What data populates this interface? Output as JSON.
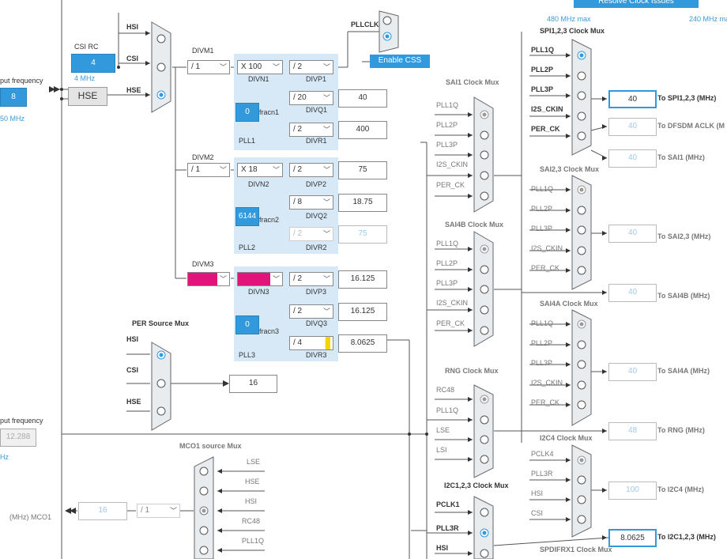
{
  "top": {
    "resolve_btn": "Resolve Clock Issues",
    "max480": "480 MHz max",
    "max240": "240 MHz max"
  },
  "left": {
    "in_freq": "put frequency",
    "hse_val": "8",
    "hse_range": "50 MHz",
    "csi_rc": "CSI RC",
    "csi_val": "4",
    "csi_mhz": "4 MHz",
    "hse_label": "HSE",
    "in_freq2": "put frequency",
    "val_12288": "12.288",
    "hz": "Hz"
  },
  "pll_src": {
    "hsi": "HSI",
    "csi": "CSI",
    "hse": "HSE"
  },
  "pll1": {
    "divm_label": "DIVM1",
    "divm": "/ 1",
    "divn": "X 100",
    "divn_label": "DIVN1",
    "divp": "/ 2",
    "divp_label": "DIVP1",
    "divq": "/ 20",
    "divq_label": "DIVQ1",
    "divq_out": "40",
    "divr": "/ 2",
    "divr_label": "DIVR1",
    "divr_out": "400",
    "frac": "0",
    "frac_label": "fracn1",
    "name": "PLL1"
  },
  "pll2": {
    "divm_label": "DIVM2",
    "divm": "/ 1",
    "divn": "X 18",
    "divn_label": "DIVN2",
    "divp": "/ 2",
    "divp_label": "DIVP2",
    "divp_out": "75",
    "divq": "/ 8",
    "divq_label": "DIVQ2",
    "divq_out": "18.75",
    "divr": "/ 2",
    "divr_label": "DIVR2",
    "divr_out": "75",
    "frac": "6144",
    "frac_label": "fracn2",
    "name": "PLL2"
  },
  "pll3": {
    "divm_label": "DIVM3",
    "divn_label": "DIVN3",
    "divp": "/ 2",
    "divp_label": "DIVP3",
    "divp_out": "16.125",
    "divq": "/ 2",
    "divq_label": "DIVQ3",
    "divq_out": "16.125",
    "divr": "/ 4",
    "divr_label": "DIVR3",
    "divr_out": "8.0625",
    "frac": "0",
    "frac_label": "fracn3",
    "name": "PLL3"
  },
  "pllclk": {
    "label": "PLLCLK",
    "enable_css": "Enable CSS"
  },
  "per_mux": {
    "title": "PER Source Mux",
    "hsi": "HSI",
    "csi": "CSI",
    "hse": "HSE",
    "out": "16"
  },
  "mco1": {
    "title": "MCO1 source Mux",
    "inputs": [
      "LSE",
      "HSE",
      "HSI",
      "RC48",
      "PLL1Q"
    ],
    "div": "/ 1",
    "val": "16",
    "label": "(MHz) MCO1"
  },
  "sai1": {
    "title": "SAI1 Clock Mux",
    "inputs": [
      "PLL1Q",
      "PLL2P",
      "PLL3P",
      "I2S_CKIN",
      "PER_CK"
    ]
  },
  "sai4b": {
    "title": "SAI4B Clock Mux",
    "inputs": [
      "PLL1Q",
      "PLL2P",
      "PLL3P",
      "I2S_CKIN",
      "PER_CK"
    ]
  },
  "rng": {
    "title": "RNG Clock Mux",
    "inputs": [
      "RC48",
      "PLL1Q",
      "LSE",
      "LSI"
    ]
  },
  "i2c123": {
    "title": "I2C1,2,3 Clock Mux",
    "inputs": [
      "PCLK1",
      "PLL3R",
      "HSI"
    ]
  },
  "spi123": {
    "title": "SPI1,2,3 Clock Mux",
    "inputs": [
      "PLL1Q",
      "PLL2P",
      "PLL3P",
      "I2S_CKIN",
      "PER_CK"
    ]
  },
  "sai23": {
    "title": "SAI2,3 Clock Mux",
    "inputs": [
      "PLL1Q",
      "PLL2P",
      "PLL3P",
      "I2S_CKIN",
      "PER_CK"
    ]
  },
  "sai4a": {
    "title": "SAI4A Clock Mux",
    "inputs": [
      "PLL1Q",
      "PLL2P",
      "PLL3P",
      "I2S_CKIN",
      "PER_CK"
    ]
  },
  "i2c4": {
    "title": "I2C4 Clock Mux",
    "inputs": [
      "PCLK4",
      "PLL3R",
      "HSI",
      "CSI"
    ]
  },
  "spdif": {
    "title": "SPDIFRX1 Clock Mux"
  },
  "outputs": [
    {
      "val": "40",
      "label": "To SPI1,2,3 (MHz)"
    },
    {
      "val": "40",
      "label": "To DFSDM ACLK (M"
    },
    {
      "val": "40",
      "label": "To SAI1 (MHz)"
    },
    {
      "val": "40",
      "label": "To SAI2,3 (MHz)"
    },
    {
      "val": "40",
      "label": "To SAI4B (MHz)"
    },
    {
      "val": "40",
      "label": "To SAI4A (MHz)"
    },
    {
      "val": "48",
      "label": "To RNG (MHz)"
    },
    {
      "val": "100",
      "label": "To I2C4 (MHz)"
    },
    {
      "val": "8.0625",
      "label": "To I2C1,2,3 (MHz)"
    }
  ]
}
